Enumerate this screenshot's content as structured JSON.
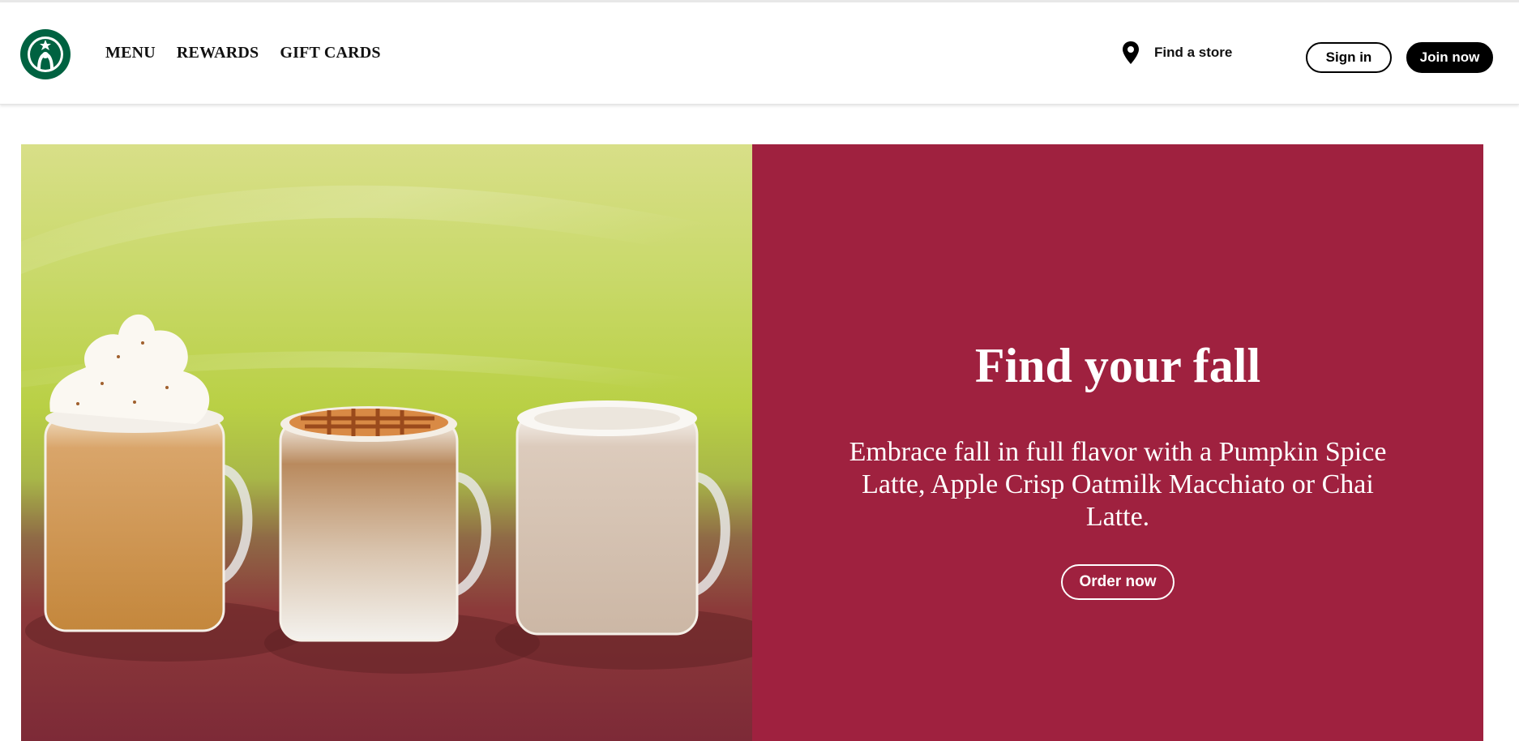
{
  "header": {
    "logo": {
      "icon": "starbucks-siren-logo",
      "color": "#006241"
    },
    "nav": [
      {
        "label": "MENU"
      },
      {
        "label": "REWARDS"
      },
      {
        "label": "GIFT CARDS"
      }
    ],
    "find_store": {
      "icon": "location-pin-icon",
      "label": "Find a store"
    },
    "sign_in_label": "Sign in",
    "join_label": "Join now"
  },
  "hero": {
    "image": {
      "subject": "three-fall-latte-mugs"
    },
    "title": "Find your fall",
    "body": "Embrace fall in full flavor with a Pumpkin Spice Latte, Apple Crisp Oatmilk Macchiato or Chai Latte.",
    "cta_label": "Order now",
    "panel_color": "#9f213f"
  }
}
